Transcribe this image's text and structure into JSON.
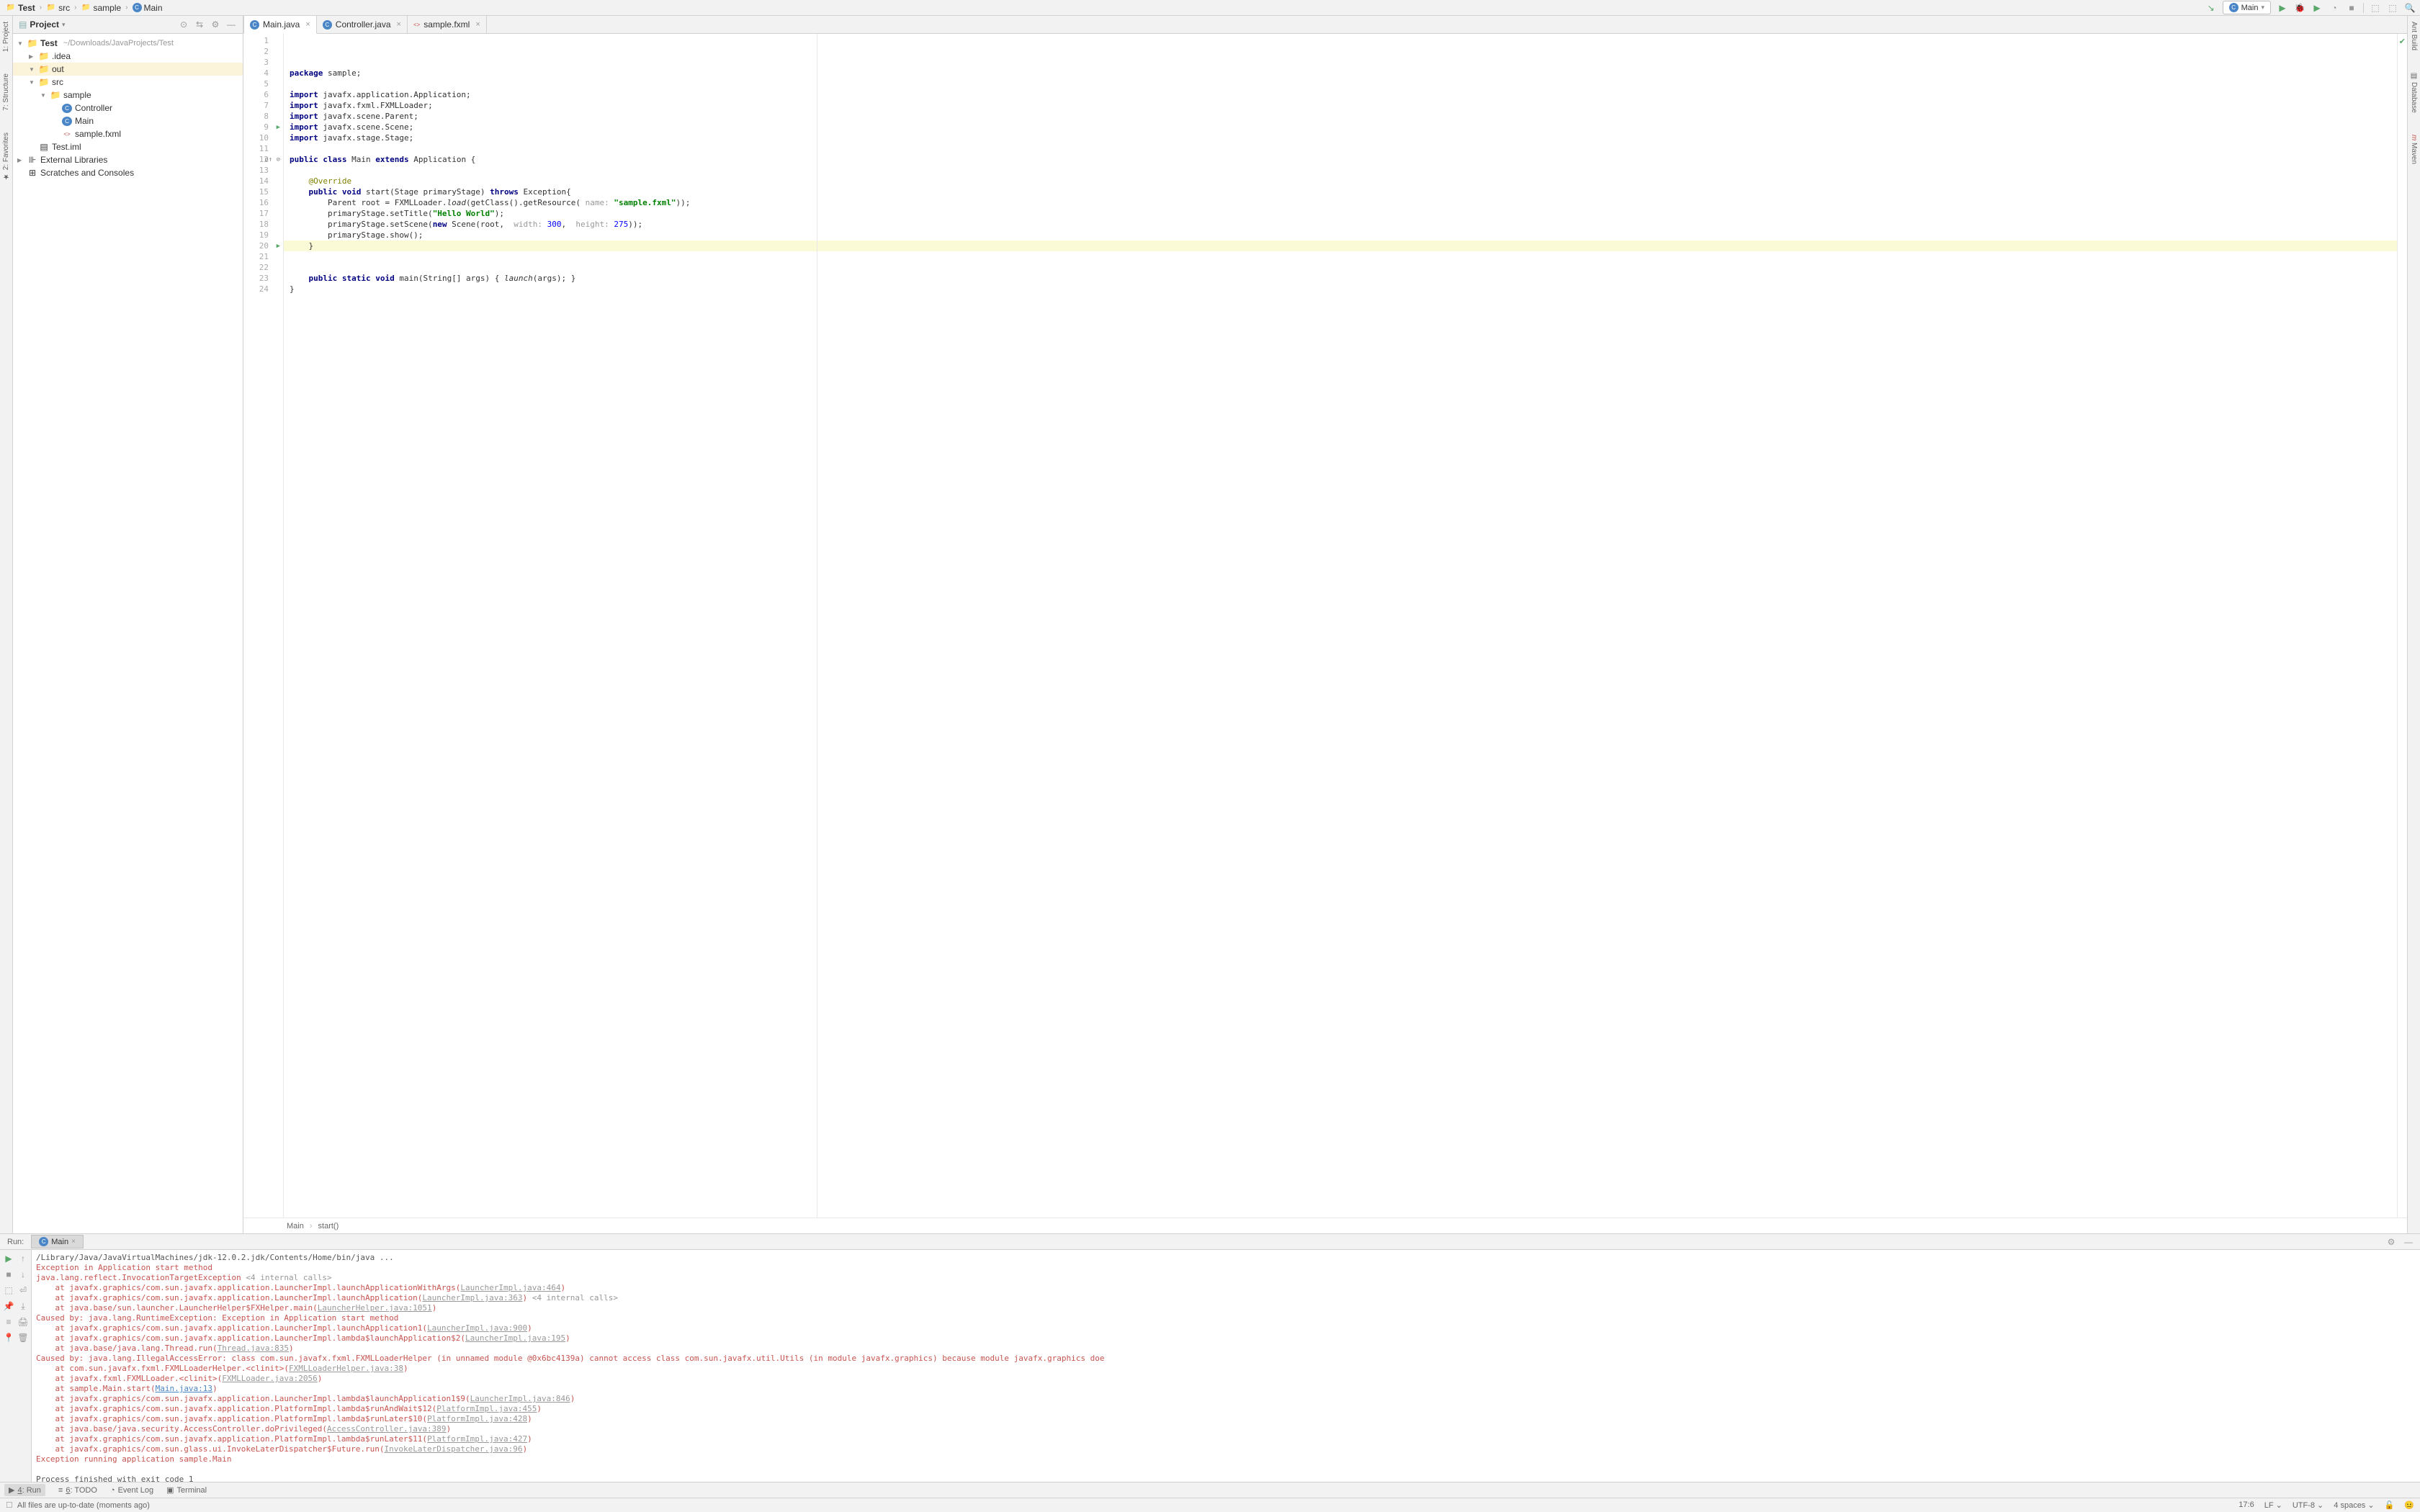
{
  "breadcrumbs": {
    "items": [
      {
        "icon": "folder",
        "label": "Test",
        "bold": true
      },
      {
        "icon": "folder",
        "label": "src"
      },
      {
        "icon": "folder",
        "label": "sample"
      },
      {
        "icon": "class",
        "label": "Main"
      }
    ]
  },
  "run_config_selector": "Main",
  "side_tools": {
    "left": [
      {
        "label": "1: Project",
        "num": "1"
      },
      {
        "label": "7: Structure",
        "num": "7"
      },
      {
        "label": "2: Favorites",
        "num": "2"
      }
    ],
    "right": [
      {
        "label": "Ant Build"
      },
      {
        "label": "Database"
      },
      {
        "label": "Maven",
        "icon": "m"
      }
    ]
  },
  "project_panel": {
    "title": "Project",
    "tree": [
      {
        "indent": 0,
        "arrow": "▼",
        "icon": "folder-blue",
        "label": "Test",
        "suffix": "~/Downloads/JavaProjects/Test",
        "bold": true
      },
      {
        "indent": 1,
        "arrow": "▶",
        "icon": "folder-blue",
        "label": ".idea"
      },
      {
        "indent": 1,
        "arrow": "▼",
        "icon": "folder-orange",
        "label": "out",
        "selected": true
      },
      {
        "indent": 1,
        "arrow": "▼",
        "icon": "folder-blue",
        "label": "src"
      },
      {
        "indent": 2,
        "arrow": "▼",
        "icon": "folder-blue",
        "label": "sample"
      },
      {
        "indent": 3,
        "arrow": "",
        "icon": "class",
        "label": "Controller"
      },
      {
        "indent": 3,
        "arrow": "",
        "icon": "class",
        "label": "Main"
      },
      {
        "indent": 3,
        "arrow": "",
        "icon": "fxml",
        "label": "sample.fxml"
      },
      {
        "indent": 1,
        "arrow": "",
        "icon": "iml",
        "label": "Test.iml"
      },
      {
        "indent": 0,
        "arrow": "▶",
        "icon": "libs",
        "label": "External Libraries"
      },
      {
        "indent": 0,
        "arrow": "",
        "icon": "scratch",
        "label": "Scratches and Consoles"
      }
    ]
  },
  "editor": {
    "tabs": [
      {
        "icon": "class",
        "label": "Main.java",
        "active": true
      },
      {
        "icon": "class",
        "label": "Controller.java"
      },
      {
        "icon": "fxml",
        "label": "sample.fxml"
      }
    ],
    "breadcrumb": {
      "left": "Main",
      "right": "start()"
    },
    "lines": [
      {
        "n": 1,
        "html": "<span class='kw'>package</span> sample;"
      },
      {
        "n": 2,
        "html": ""
      },
      {
        "n": 3,
        "html": "<span class='kw'>import</span> javafx.application.Application;"
      },
      {
        "n": 4,
        "html": "<span class='kw'>import</span> javafx.fxml.FXMLLoader;"
      },
      {
        "n": 5,
        "html": "<span class='kw'>import</span> javafx.scene.Parent;"
      },
      {
        "n": 6,
        "html": "<span class='kw'>import</span> javafx.scene.Scene;"
      },
      {
        "n": 7,
        "html": "<span class='kw'>import</span> javafx.stage.Stage;"
      },
      {
        "n": 8,
        "html": ""
      },
      {
        "n": 9,
        "html": "<span class='kw'>public class</span> Main <span class='kw'>extends</span> Application {",
        "run": true
      },
      {
        "n": 10,
        "html": ""
      },
      {
        "n": 11,
        "html": "    <span class='ann'>@Override</span>"
      },
      {
        "n": 12,
        "html": "    <span class='kw'>public void</span> start(Stage primaryStage) <span class='kw'>throws</span> Exception{",
        "marker": "o↑ ⊘"
      },
      {
        "n": 13,
        "html": "        Parent root = FXMLLoader.<span class='stat'>load</span>(getClass().getResource( <span class='hint'>name:</span> <span class='str'>\"sample.fxml\"</span>));"
      },
      {
        "n": 14,
        "html": "        primaryStage.setTitle(<span class='str'>\"Hello World\"</span>);"
      },
      {
        "n": 15,
        "html": "        primaryStage.setScene(<span class='kw'>new</span> Scene(root,  <span class='hint'>width:</span> <span class='num'>300</span>,  <span class='hint'>height:</span> <span class='num'>275</span>));"
      },
      {
        "n": 16,
        "html": "        primaryStage.show();"
      },
      {
        "n": 17,
        "html": "    }",
        "hl": true
      },
      {
        "n": 18,
        "html": ""
      },
      {
        "n": 19,
        "html": ""
      },
      {
        "n": 20,
        "html": "    <span class='kw'>public static void</span> main(String[] args) { <span class='stat'>launch</span>(args); }",
        "run": true
      },
      {
        "n": 21,
        "html": "}"
      },
      {
        "n": 22,
        "html": ""
      },
      {
        "n": 23,
        "html": ""
      },
      {
        "n": 24,
        "html": ""
      }
    ]
  },
  "run_panel": {
    "label": "Run:",
    "tab": "Main",
    "console": [
      {
        "cls": "",
        "text": "/Library/Java/JavaVirtualMachines/jdk-12.0.2.jdk/Contents/Home/bin/java ..."
      },
      {
        "cls": "red",
        "text": "Exception in Application start method"
      },
      {
        "cls": "red",
        "text": "java.lang.reflect.InvocationTargetException <span class='gray'>&lt;4 internal calls&gt;</span>"
      },
      {
        "cls": "red",
        "text": "    at javafx.graphics/com.sun.javafx.application.LauncherImpl.launchApplicationWithArgs(<span class='link'>LauncherImpl.java:464</span>)"
      },
      {
        "cls": "red",
        "text": "    at javafx.graphics/com.sun.javafx.application.LauncherImpl.launchApplication(<span class='link'>LauncherImpl.java:363</span>) <span class='gray'>&lt;4 internal calls&gt;</span>"
      },
      {
        "cls": "red",
        "text": "    at java.base/sun.launcher.LauncherHelper$FXHelper.main(<span class='link'>LauncherHelper.java:1051</span>)"
      },
      {
        "cls": "red",
        "text": "Caused by: java.lang.RuntimeException: Exception in Application start method"
      },
      {
        "cls": "red",
        "text": "    at javafx.graphics/com.sun.javafx.application.LauncherImpl.launchApplication1(<span class='link'>LauncherImpl.java:900</span>)"
      },
      {
        "cls": "red",
        "text": "    at javafx.graphics/com.sun.javafx.application.LauncherImpl.lambda$launchApplication$2(<span class='link'>LauncherImpl.java:195</span>)"
      },
      {
        "cls": "red",
        "text": "    at java.base/java.lang.Thread.run(<span class='link'>Thread.java:835</span>)"
      },
      {
        "cls": "red",
        "text": "Caused by: java.lang.IllegalAccessError: class com.sun.javafx.fxml.FXMLLoaderHelper (in unnamed module @0x6bc4139a) cannot access class com.sun.javafx.util.Utils (in module javafx.graphics) because module javafx.graphics doe"
      },
      {
        "cls": "red",
        "text": "    at com.sun.javafx.fxml.FXMLLoaderHelper.&lt;clinit&gt;(<span class='link'>FXMLLoaderHelper.java:38</span>)"
      },
      {
        "cls": "red",
        "text": "    at javafx.fxml.FXMLLoader.&lt;clinit&gt;(<span class='link'>FXMLLoader.java:2056</span>)"
      },
      {
        "cls": "red",
        "text": "    at sample.Main.start(<span class='blue-link'>Main.java:13</span>)"
      },
      {
        "cls": "red",
        "text": "    at javafx.graphics/com.sun.javafx.application.LauncherImpl.lambda$launchApplication1$9(<span class='link'>LauncherImpl.java:846</span>)"
      },
      {
        "cls": "red",
        "text": "    at javafx.graphics/com.sun.javafx.application.PlatformImpl.lambda$runAndWait$12(<span class='link'>PlatformImpl.java:455</span>)"
      },
      {
        "cls": "red",
        "text": "    at javafx.graphics/com.sun.javafx.application.PlatformImpl.lambda$runLater$10(<span class='link'>PlatformImpl.java:428</span>)"
      },
      {
        "cls": "red",
        "text": "    at java.base/java.security.AccessController.doPrivileged(<span class='link'>AccessController.java:389</span>)"
      },
      {
        "cls": "red",
        "text": "    at javafx.graphics/com.sun.javafx.application.PlatformImpl.lambda$runLater$11(<span class='link'>PlatformImpl.java:427</span>)"
      },
      {
        "cls": "red",
        "text": "    at javafx.graphics/com.sun.glass.ui.InvokeLaterDispatcher$Future.run(<span class='link'>InvokeLaterDispatcher.java:96</span>)"
      },
      {
        "cls": "red",
        "text": "Exception running application sample.Main"
      },
      {
        "cls": "",
        "text": ""
      },
      {
        "cls": "",
        "text": "Process finished with exit code 1"
      }
    ]
  },
  "bottom_tools": [
    {
      "label": "4: Run",
      "key": "4",
      "active": true,
      "icon": "▶"
    },
    {
      "label": "6: TODO",
      "key": "6",
      "icon": "≡"
    },
    {
      "label": "Event Log",
      "icon": "◔"
    },
    {
      "label": "Terminal",
      "icon": "▣"
    }
  ],
  "status_bar": {
    "message": "All files are up-to-date (moments ago)",
    "cursor": "17:6",
    "line_sep": "LF",
    "encoding": "UTF-8",
    "indent": "4 spaces"
  }
}
